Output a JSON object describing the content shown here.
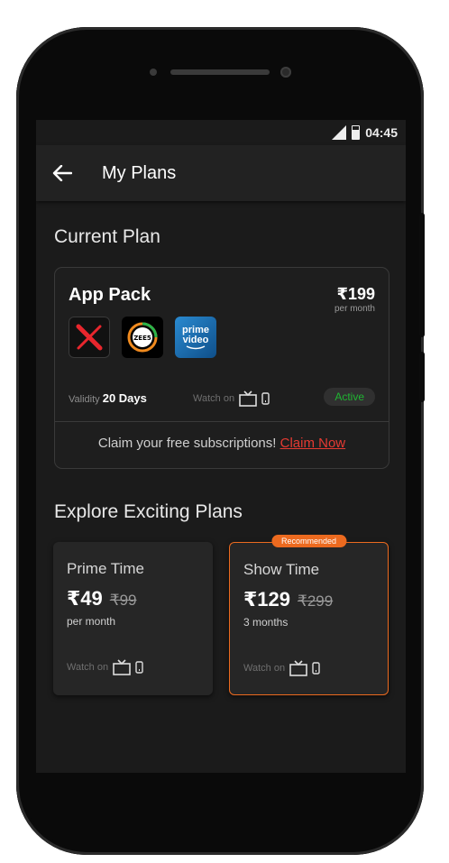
{
  "status_bar": {
    "time": "04:45",
    "signal_icon": "cellular-signal-icon",
    "battery_icon": "battery-icon"
  },
  "app_bar": {
    "back_icon": "arrow-back-icon",
    "title": "My Plans"
  },
  "current_plan": {
    "section_title": "Current Plan",
    "pack_name": "App Pack",
    "price": "₹199",
    "price_period": "per month",
    "apps": [
      {
        "name": "x-app-logo"
      },
      {
        "name": "zee5-logo",
        "text": "ZEE5"
      },
      {
        "name": "prime-video-logo",
        "text_line1": "prime",
        "text_line2": "video"
      }
    ],
    "validity_label": "Validity",
    "validity_value": "20 Days",
    "watch_on_label": "Watch on",
    "devices": [
      "tv-icon",
      "mobile-icon"
    ],
    "status": "Active",
    "claim_text": "Claim your free subscriptions!",
    "claim_link": "Claim Now"
  },
  "explore": {
    "section_title": "Explore Exciting Plans",
    "plans": [
      {
        "name": "Prime Time",
        "price": "₹49",
        "old_price": "₹99",
        "period": "per month",
        "watch_on_label": "Watch on",
        "recommended": false
      },
      {
        "name": "Show Time",
        "price": "₹129",
        "old_price": "₹299",
        "period": "3 months",
        "watch_on_label": "Watch on",
        "recommended": true,
        "tag": "Recommended"
      }
    ]
  },
  "colors": {
    "accent": "#ec6a1f",
    "active": "#1fb432",
    "link": "#e53a32",
    "background": "#1b1b1b"
  }
}
